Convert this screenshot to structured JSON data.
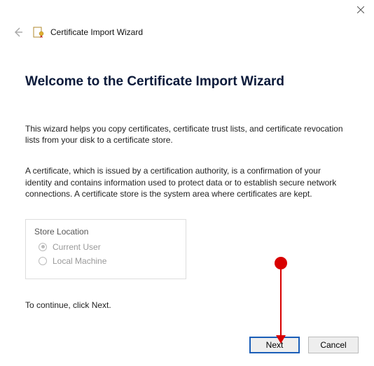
{
  "window": {
    "title": "Certificate Import Wizard"
  },
  "main": {
    "heading": "Welcome to the Certificate Import Wizard",
    "para1": "This wizard helps you copy certificates, certificate trust lists, and certificate revocation lists from your disk to a certificate store.",
    "para2": "A certificate, which is issued by a certification authority, is a confirmation of your identity and contains information used to protect data or to establish secure network connections. A certificate store is the system area where certificates are kept.",
    "storeLocation": {
      "legend": "Store Location",
      "options": {
        "currentUser": "Current User",
        "localMachine": "Local Machine"
      },
      "selected": "currentUser",
      "enabled": false
    },
    "continueText": "To continue, click Next."
  },
  "buttons": {
    "next": "Next",
    "cancel": "Cancel"
  },
  "icons": {
    "back": "back-arrow-icon",
    "close": "close-icon",
    "certificate": "certificate-icon"
  },
  "colors": {
    "headingText": "#0b1a3a",
    "primaryBorder": "#1a5eb8",
    "annotation": "#d80000"
  }
}
